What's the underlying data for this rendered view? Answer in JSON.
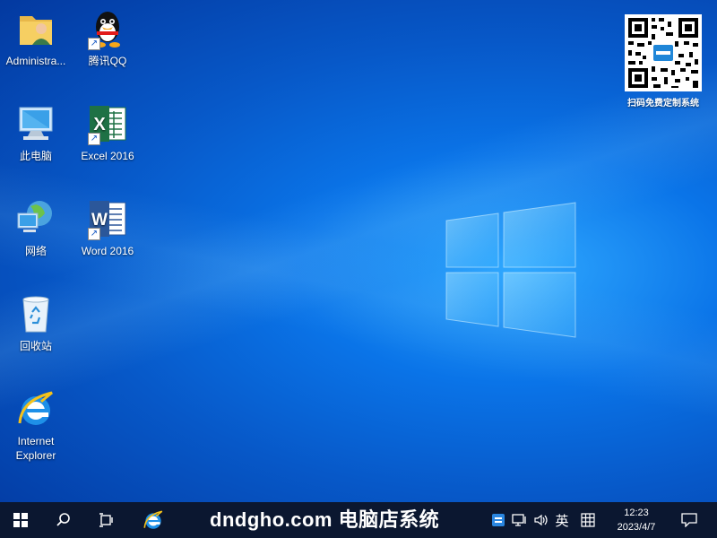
{
  "desktop": {
    "icons": [
      {
        "label": "Administra...",
        "icon": "user-folder-icon"
      },
      {
        "label": "腾讯QQ",
        "icon": "qq-penguin-icon"
      },
      {
        "label": "此电脑",
        "icon": "computer-icon"
      },
      {
        "label": "Excel 2016",
        "icon": "excel-icon"
      },
      {
        "label": "网络",
        "icon": "network-icon"
      },
      {
        "label": "Word 2016",
        "icon": "word-icon"
      },
      {
        "label": "回收站",
        "icon": "recycle-bin-icon"
      },
      {
        "label": "Internet Explorer",
        "icon": "internet-explorer-icon"
      }
    ],
    "qr_caption": "扫码免费定制系统"
  },
  "taskbar": {
    "banner": "dndgho.com 电脑店系统",
    "ime_label": "英",
    "time": "12:23",
    "date": "2023/4/7"
  },
  "colors": {
    "taskbar": "#0b1730",
    "desktop_accent": "#0a74e8"
  }
}
